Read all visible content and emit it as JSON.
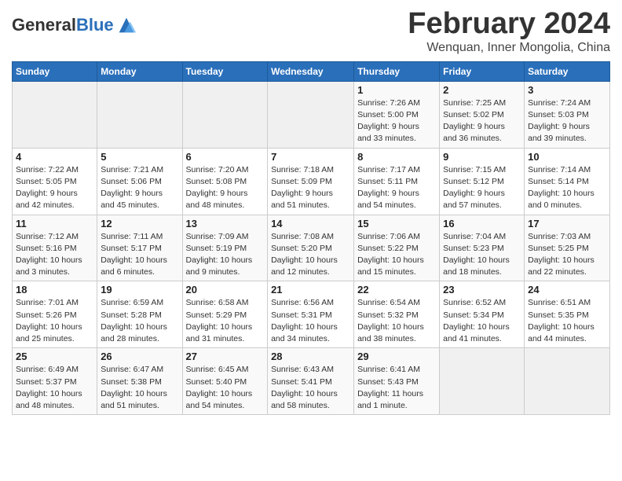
{
  "header": {
    "logo_general": "General",
    "logo_blue": "Blue",
    "month_title": "February 2024",
    "location": "Wenquan, Inner Mongolia, China"
  },
  "days_of_week": [
    "Sunday",
    "Monday",
    "Tuesday",
    "Wednesday",
    "Thursday",
    "Friday",
    "Saturday"
  ],
  "weeks": [
    {
      "days": [
        {
          "number": "",
          "detail": "",
          "empty": true
        },
        {
          "number": "",
          "detail": "",
          "empty": true
        },
        {
          "number": "",
          "detail": "",
          "empty": true
        },
        {
          "number": "",
          "detail": "",
          "empty": true
        },
        {
          "number": "1",
          "detail": "Sunrise: 7:26 AM\nSunset: 5:00 PM\nDaylight: 9 hours\nand 33 minutes."
        },
        {
          "number": "2",
          "detail": "Sunrise: 7:25 AM\nSunset: 5:02 PM\nDaylight: 9 hours\nand 36 minutes."
        },
        {
          "number": "3",
          "detail": "Sunrise: 7:24 AM\nSunset: 5:03 PM\nDaylight: 9 hours\nand 39 minutes."
        }
      ]
    },
    {
      "days": [
        {
          "number": "4",
          "detail": "Sunrise: 7:22 AM\nSunset: 5:05 PM\nDaylight: 9 hours\nand 42 minutes."
        },
        {
          "number": "5",
          "detail": "Sunrise: 7:21 AM\nSunset: 5:06 PM\nDaylight: 9 hours\nand 45 minutes."
        },
        {
          "number": "6",
          "detail": "Sunrise: 7:20 AM\nSunset: 5:08 PM\nDaylight: 9 hours\nand 48 minutes."
        },
        {
          "number": "7",
          "detail": "Sunrise: 7:18 AM\nSunset: 5:09 PM\nDaylight: 9 hours\nand 51 minutes."
        },
        {
          "number": "8",
          "detail": "Sunrise: 7:17 AM\nSunset: 5:11 PM\nDaylight: 9 hours\nand 54 minutes."
        },
        {
          "number": "9",
          "detail": "Sunrise: 7:15 AM\nSunset: 5:12 PM\nDaylight: 9 hours\nand 57 minutes."
        },
        {
          "number": "10",
          "detail": "Sunrise: 7:14 AM\nSunset: 5:14 PM\nDaylight: 10 hours\nand 0 minutes."
        }
      ]
    },
    {
      "days": [
        {
          "number": "11",
          "detail": "Sunrise: 7:12 AM\nSunset: 5:16 PM\nDaylight: 10 hours\nand 3 minutes."
        },
        {
          "number": "12",
          "detail": "Sunrise: 7:11 AM\nSunset: 5:17 PM\nDaylight: 10 hours\nand 6 minutes."
        },
        {
          "number": "13",
          "detail": "Sunrise: 7:09 AM\nSunset: 5:19 PM\nDaylight: 10 hours\nand 9 minutes."
        },
        {
          "number": "14",
          "detail": "Sunrise: 7:08 AM\nSunset: 5:20 PM\nDaylight: 10 hours\nand 12 minutes."
        },
        {
          "number": "15",
          "detail": "Sunrise: 7:06 AM\nSunset: 5:22 PM\nDaylight: 10 hours\nand 15 minutes."
        },
        {
          "number": "16",
          "detail": "Sunrise: 7:04 AM\nSunset: 5:23 PM\nDaylight: 10 hours\nand 18 minutes."
        },
        {
          "number": "17",
          "detail": "Sunrise: 7:03 AM\nSunset: 5:25 PM\nDaylight: 10 hours\nand 22 minutes."
        }
      ]
    },
    {
      "days": [
        {
          "number": "18",
          "detail": "Sunrise: 7:01 AM\nSunset: 5:26 PM\nDaylight: 10 hours\nand 25 minutes."
        },
        {
          "number": "19",
          "detail": "Sunrise: 6:59 AM\nSunset: 5:28 PM\nDaylight: 10 hours\nand 28 minutes."
        },
        {
          "number": "20",
          "detail": "Sunrise: 6:58 AM\nSunset: 5:29 PM\nDaylight: 10 hours\nand 31 minutes."
        },
        {
          "number": "21",
          "detail": "Sunrise: 6:56 AM\nSunset: 5:31 PM\nDaylight: 10 hours\nand 34 minutes."
        },
        {
          "number": "22",
          "detail": "Sunrise: 6:54 AM\nSunset: 5:32 PM\nDaylight: 10 hours\nand 38 minutes."
        },
        {
          "number": "23",
          "detail": "Sunrise: 6:52 AM\nSunset: 5:34 PM\nDaylight: 10 hours\nand 41 minutes."
        },
        {
          "number": "24",
          "detail": "Sunrise: 6:51 AM\nSunset: 5:35 PM\nDaylight: 10 hours\nand 44 minutes."
        }
      ]
    },
    {
      "days": [
        {
          "number": "25",
          "detail": "Sunrise: 6:49 AM\nSunset: 5:37 PM\nDaylight: 10 hours\nand 48 minutes."
        },
        {
          "number": "26",
          "detail": "Sunrise: 6:47 AM\nSunset: 5:38 PM\nDaylight: 10 hours\nand 51 minutes."
        },
        {
          "number": "27",
          "detail": "Sunrise: 6:45 AM\nSunset: 5:40 PM\nDaylight: 10 hours\nand 54 minutes."
        },
        {
          "number": "28",
          "detail": "Sunrise: 6:43 AM\nSunset: 5:41 PM\nDaylight: 10 hours\nand 58 minutes."
        },
        {
          "number": "29",
          "detail": "Sunrise: 6:41 AM\nSunset: 5:43 PM\nDaylight: 11 hours\nand 1 minute."
        },
        {
          "number": "",
          "detail": "",
          "empty": true
        },
        {
          "number": "",
          "detail": "",
          "empty": true
        }
      ]
    }
  ]
}
